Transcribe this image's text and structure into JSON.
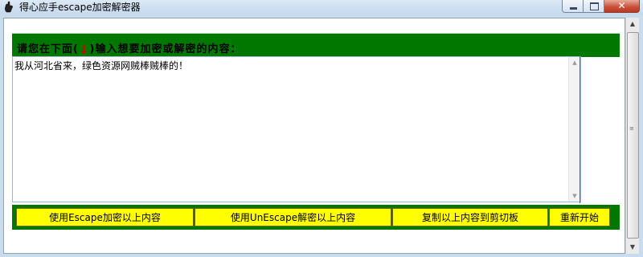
{
  "window": {
    "title": "得心应手escape加密解密器",
    "close_glyph": "✕"
  },
  "header": {
    "label_before": "请您在下面(",
    "arrow_glyph": "↓",
    "label_after": ")输入想要加密或解密的内容："
  },
  "editor": {
    "value": "我从河北省来，绿色资源网贼棒贼棒的！"
  },
  "buttons": {
    "escape": "使用Escape加密以上内容",
    "unescape": "使用UnEscape解密以上内容",
    "copy": "复制以上内容到剪切板",
    "restart": "重新开始"
  },
  "colors": {
    "accent_green": "#007800",
    "button_yellow": "#ffff00",
    "arrow_red": "#d40000"
  }
}
